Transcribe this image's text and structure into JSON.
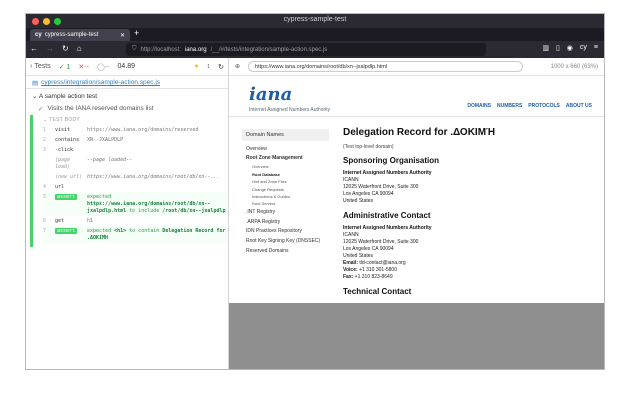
{
  "window": {
    "title": "cypress-sample-test"
  },
  "tabs": [
    {
      "label": "cypress-sample-test",
      "icon": "cy"
    }
  ],
  "browser": {
    "url_prefix": "http://localhost:",
    "url_host": "iana.org",
    "url_path": "/__/#/tests/integration/sample-action.spec.js"
  },
  "stats": {
    "tests_label": "Tests",
    "passed": "1",
    "failed": "--",
    "pending": "--",
    "duration": "04.89"
  },
  "spec": {
    "path": "cypress/integration/sample-action.spec.js"
  },
  "suite": {
    "title": "A sample action test"
  },
  "test": {
    "title": "Visits the IANA reserved domains list",
    "body_label": "TEST BODY"
  },
  "commands": [
    {
      "num": "1",
      "name": "visit",
      "msg": "https://www.iana.org/domains/reserved"
    },
    {
      "num": "2",
      "name": "contains",
      "msg": "XN--JXALPDLP"
    },
    {
      "num": "3",
      "name": "-click",
      "msg": ""
    },
    {
      "num": "",
      "name": "(page load)",
      "msg": "--page loaded--",
      "muted": true
    },
    {
      "num": "",
      "name": "(new url)",
      "msg": "https://www.iana.org/domains/root/db/xn--...",
      "muted": true
    },
    {
      "num": "4",
      "name": "url",
      "msg": ""
    },
    {
      "num": "5",
      "name": "assert",
      "msg_pre": "expected ",
      "msg_val": "https://www.iana.org/domains/root/db/xn--jxalpdlp.html",
      "msg_mid": " to include ",
      "msg_val2": "/root/db/xn--jxalpdlp",
      "assert": true
    },
    {
      "num": "6",
      "name": "get",
      "msg": "h1"
    },
    {
      "num": "7",
      "name": "assert",
      "msg_pre": "expected ",
      "msg_val": "<h1>",
      "msg_mid": " to contain ",
      "msg_val2": "Delegation Record for .ΔΟΚΙΜΉ",
      "assert": true
    }
  ],
  "aut": {
    "url": "https://www.iana.org/domains/root/db/xn--jxalpdlp.html",
    "size": "1000 x 660",
    "scale": "(63%)"
  },
  "iana": {
    "logo": "iana",
    "logo_sub": "Internet Assigned Numbers Authority",
    "nav": [
      "DOMAINS",
      "NUMBERS",
      "PROTOCOLS",
      "ABOUT US"
    ],
    "sidebar_head": "Domain Names",
    "sidebar": [
      {
        "label": "Overview",
        "level": 0
      },
      {
        "label": "Root Zone Management",
        "level": 0,
        "active": true
      },
      {
        "label": "Overview",
        "level": 1
      },
      {
        "label": "Root Database",
        "level": 1,
        "active": true
      },
      {
        "label": "Hint and Zone Files",
        "level": 1
      },
      {
        "label": "Change Requests",
        "level": 1
      },
      {
        "label": "Instructions & Guides",
        "level": 1
      },
      {
        "label": "Root Servers",
        "level": 1
      },
      {
        "label": ".INT Registry",
        "level": 0
      },
      {
        "label": ".ARPA Registry",
        "level": 0
      },
      {
        "label": "IDN Practices Repository",
        "level": 0
      },
      {
        "label": "Root Key Signing Key (DNSSEC)",
        "level": 0
      },
      {
        "label": "Reserved Domains",
        "level": 0
      }
    ],
    "heading": "Delegation Record for .ΔΟΚΙΜΉ",
    "note": "(Test top-level domain)",
    "sponsor_heading": "Sponsoring Organisation",
    "sponsor_org": "Internet Assigned Numbers Authority",
    "sponsor_lines": [
      "ICANN",
      "12025 Waterfront Drive, Suite 300",
      "Los Angeles CA 90094",
      "United States"
    ],
    "admin_heading": "Administrative Contact",
    "admin_org": "Internet Assigned Numbers Authority",
    "admin_lines": [
      "ICANN",
      "12025 Waterfront Drive, Suite 300",
      "Los Angeles CA 90094",
      "United States"
    ],
    "admin_email_label": "Email:",
    "admin_email": "tld-contact@iana.org",
    "admin_voice_label": "Voice:",
    "admin_voice": "+1 310 301-5800",
    "admin_fax_label": "Fax:",
    "admin_fax": "+1 310 823-8649",
    "tech_heading": "Technical Contact"
  }
}
